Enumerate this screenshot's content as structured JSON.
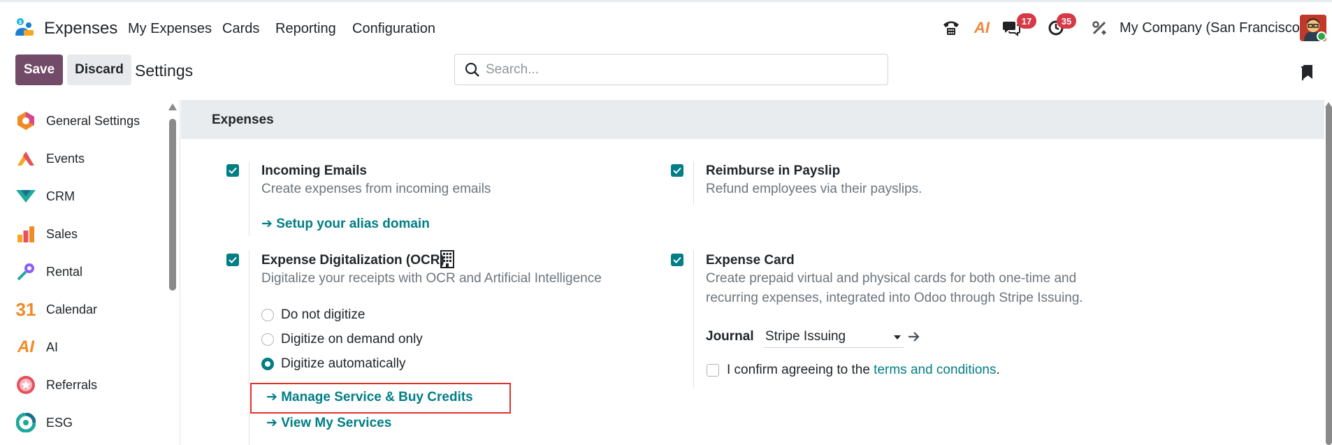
{
  "navbar": {
    "app_name": "Expenses",
    "menu": [
      "My Expenses",
      "Cards",
      "Reporting",
      "Configuration"
    ],
    "ai_label": "AI",
    "messages_count": "17",
    "activities_count": "35",
    "company": "My Company (San Francisco)"
  },
  "control_panel": {
    "save_label": "Save",
    "discard_label": "Discard",
    "title": "Settings",
    "search_placeholder": "Search..."
  },
  "sidebar": {
    "items": [
      {
        "label": "General Settings",
        "icon": "general-settings-icon"
      },
      {
        "label": "Events",
        "icon": "events-icon"
      },
      {
        "label": "CRM",
        "icon": "crm-icon"
      },
      {
        "label": "Sales",
        "icon": "sales-icon"
      },
      {
        "label": "Rental",
        "icon": "rental-icon"
      },
      {
        "label": "Calendar",
        "icon": "calendar-icon"
      },
      {
        "label": "AI",
        "icon": "ai-icon"
      },
      {
        "label": "Referrals",
        "icon": "referrals-icon"
      },
      {
        "label": "ESG",
        "icon": "esg-icon"
      }
    ],
    "calendar_number": "31"
  },
  "main": {
    "section_title": "Expenses",
    "incoming_emails": {
      "title": "Incoming Emails",
      "desc": "Create expenses from incoming emails",
      "link": "➔ Setup your alias domain",
      "checked": true
    },
    "reimburse_payslip": {
      "title": "Reimburse in Payslip",
      "desc": "Refund employees via their payslips.",
      "checked": true
    },
    "ocr": {
      "title": "Expense Digitalization (OCR)",
      "desc": "Digitalize your receipts with OCR and Artificial Intelligence",
      "options": [
        "Do not digitize",
        "Digitize on demand only",
        "Digitize automatically"
      ],
      "selected": "Digitize automatically",
      "link_manage": "➔ Manage Service & Buy Credits",
      "link_view": "➔ View My Services",
      "checked": true
    },
    "expense_card": {
      "title": "Expense Card",
      "desc_line1": "Create prepaid virtual and physical cards for both one-time and",
      "desc_line2": "recurring expenses, integrated into Odoo through Stripe Issuing.",
      "journal_label": "Journal",
      "journal_value": "Stripe Issuing",
      "confirm_text": "I confirm agreeing to the ",
      "confirm_link": "terms and conditions",
      "confirm_end": ".",
      "checked": true
    }
  },
  "colors": {
    "primary": "#714b67",
    "accent": "#017e84",
    "badge": "#d63846",
    "highlight": "#e0312d"
  }
}
